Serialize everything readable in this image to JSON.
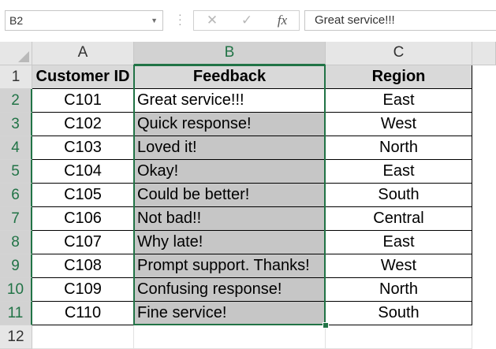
{
  "name_box": {
    "value": "B2"
  },
  "formula_bar": {
    "cancel_icon": "x-icon",
    "enter_icon": "check-icon",
    "fx_label": "fx",
    "content": "Great service!!!"
  },
  "columns": [
    "A",
    "B",
    "C"
  ],
  "rows": [
    "1",
    "2",
    "3",
    "4",
    "5",
    "6",
    "7",
    "8",
    "9",
    "10",
    "11",
    "12"
  ],
  "selected_column": "B",
  "active_cell": "B2",
  "table": {
    "headers": [
      "Customer ID",
      "Feedback",
      "Region"
    ],
    "rows": [
      [
        "C101",
        "Great service!!!",
        "East"
      ],
      [
        "C102",
        "Quick response!",
        "West"
      ],
      [
        "C103",
        "Loved it!",
        "North"
      ],
      [
        "C104",
        "Okay!",
        "East"
      ],
      [
        "C105",
        "Could be better!",
        "South"
      ],
      [
        "C106",
        "Not bad!!",
        "Central"
      ],
      [
        "C107",
        "Why late!",
        "East"
      ],
      [
        "C108",
        "Prompt support. Thanks!",
        "West"
      ],
      [
        "C109",
        "Confusing response!",
        "North"
      ],
      [
        "C110",
        "Fine service!",
        "South"
      ]
    ]
  },
  "colors": {
    "excel_green": "#217346",
    "selection_fill": "#c6c6c6",
    "header_fill": "#d9d9d9"
  }
}
